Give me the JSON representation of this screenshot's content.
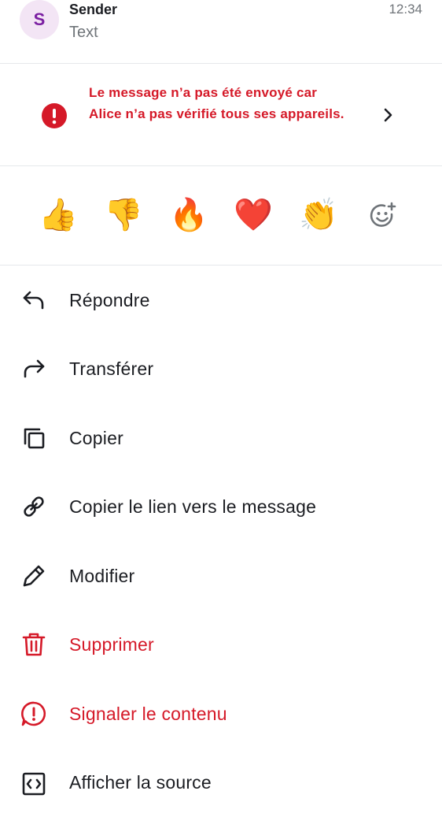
{
  "header": {
    "avatar_letter": "S",
    "sender": "Sender",
    "message_text": "Text",
    "time": "12:34"
  },
  "alert": {
    "text": "Le message n’a pas été envoyé car Alice n’a pas vérifié tous ses appareils.",
    "icon": "error-circle-icon"
  },
  "reactions": {
    "emojis": [
      "👍",
      "👎",
      "🔥",
      "❤️",
      "👏"
    ],
    "add_icon": "add-reaction-icon"
  },
  "menu": {
    "items": [
      {
        "label": "Répondre",
        "icon": "reply-icon"
      },
      {
        "label": "Transférer",
        "icon": "forward-icon"
      },
      {
        "label": "Copier",
        "icon": "copy-icon"
      },
      {
        "label": "Copier le lien vers le message",
        "icon": "link-icon"
      },
      {
        "label": "Modifier",
        "icon": "edit-icon"
      },
      {
        "label": "Supprimer",
        "icon": "delete-icon"
      },
      {
        "label": "Signaler le contenu",
        "icon": "report-icon"
      },
      {
        "label": "Afficher la source",
        "icon": "view-source-icon"
      }
    ]
  },
  "colors": {
    "danger": "#d51928",
    "text": "#1b1d22",
    "secondary": "#6f7479",
    "avatar_bg": "#f3e5f5",
    "avatar_fg": "#7b1fa2"
  }
}
